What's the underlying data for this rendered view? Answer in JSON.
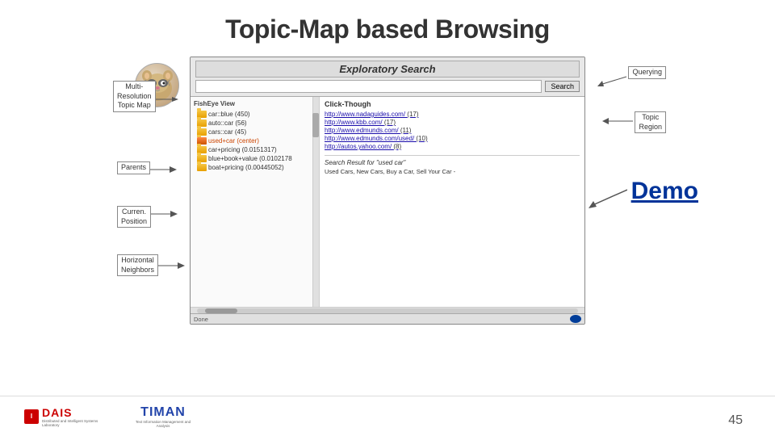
{
  "slide": {
    "title": "Topic-Map based Browsing",
    "page_number": "45"
  },
  "labels": {
    "multi_resolution": "Multi-\nResolution\nTopic Map",
    "querying": "Querying",
    "topic_region": "Topic\nRegion",
    "parents": "Parents",
    "current_position": "Curren.\nPosition",
    "horizontal_neighbors": "Horizontal\nNeighbors",
    "demo": "Demo"
  },
  "browser": {
    "title": "Exploratory Search",
    "search_placeholder": "",
    "search_button": "Search",
    "status": "Done"
  },
  "fisheye": {
    "title": "FishEye View",
    "items": [
      {
        "label": "car::blue (450)",
        "highlight": false
      },
      {
        "label": "auto::car (56)",
        "highlight": false
      },
      {
        "label": "cars::car (45)",
        "highlight": false
      },
      {
        "label": "used+car (center)",
        "highlight": true
      },
      {
        "label": "car+pricing (0.0151317)",
        "highlight": false
      },
      {
        "label": "blue+book+value (0.0102178",
        "highlight": false
      },
      {
        "label": "boat+pricing (0.00445052)",
        "highlight": false
      }
    ]
  },
  "click_through": {
    "title": "Click-Though",
    "results": [
      {
        "url": "http://www.nadaguides.com/",
        "count": "(17)"
      },
      {
        "url": "http://www.kbb.com/",
        "count": "(17)"
      },
      {
        "url": "http://www.edmunds.com/",
        "count": "(11)"
      },
      {
        "url": "http://www.edmunds.com/used/",
        "count": "(10)"
      },
      {
        "url": "http://autos.yahoo.com/",
        "count": "(8)"
      }
    ],
    "search_result_label": "Search Result for \"used car\"",
    "search_result_text": "Used Cars, New Cars, Buy a Car, Sell Your Car -"
  },
  "logos": {
    "dais_text": "DAIS",
    "dais_sub": "Distributed and Intelligent Systems Laboratory",
    "timan_text": "TIMAN",
    "timan_sub": "Text Information Management and Analysis"
  }
}
